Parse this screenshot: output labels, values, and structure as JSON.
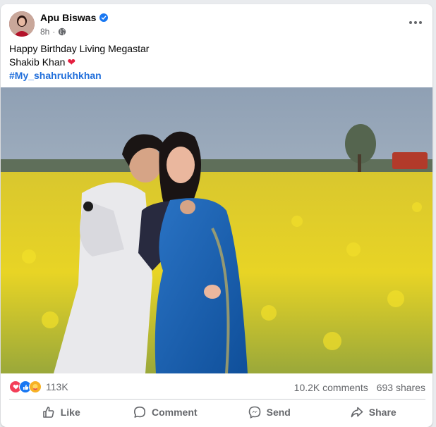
{
  "post": {
    "author": "Apu Biswas",
    "time": "8h",
    "caption_line1": "Happy Birthday Living Megastar",
    "caption_line2": "Shakib Khan",
    "hashtag": "#My_shahrukhkhan"
  },
  "stats": {
    "reactions_count": "113K",
    "comments": "10.2K comments",
    "shares": "693 shares"
  },
  "actions": {
    "like": "Like",
    "comment": "Comment",
    "send": "Send",
    "share": "Share"
  },
  "colors": {
    "brand_blue": "#1877f2",
    "hashtag_blue": "#216fdb",
    "heart_red": "#e41e3f"
  }
}
